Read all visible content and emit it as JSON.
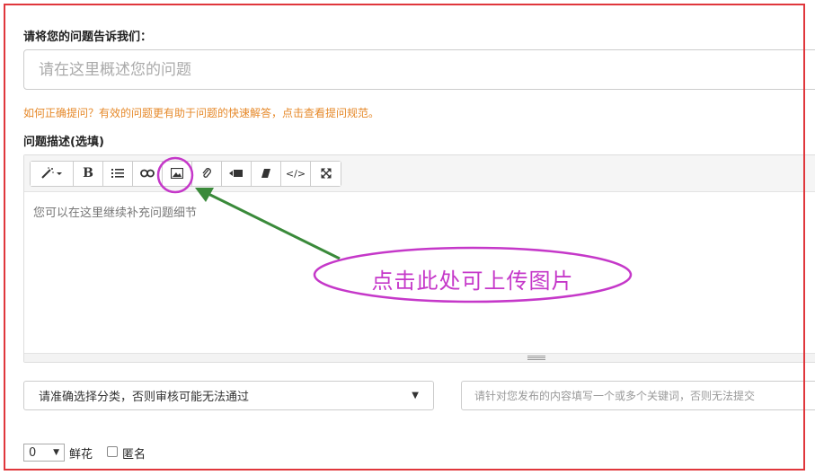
{
  "form": {
    "question_label": "请将您的问题告诉我们：",
    "title_placeholder": "请在这里概述您的问题",
    "help_text": "如何正确提问？有效的问题更有助于问题的快速解答，点击查看提问规范。",
    "description_label": "问题描述(选填)"
  },
  "editor": {
    "toolbar": [
      {
        "name": "magic-wand-icon",
        "glyph": "✎▾"
      },
      {
        "name": "bold-icon",
        "glyph": "B"
      },
      {
        "name": "ordered-list-icon",
        "glyph": "≡"
      },
      {
        "name": "link-icon",
        "glyph": "∞"
      },
      {
        "name": "image-icon",
        "glyph": "▣"
      },
      {
        "name": "attachment-icon",
        "glyph": "⌀"
      },
      {
        "name": "video-icon",
        "glyph": "▶"
      },
      {
        "name": "eraser-icon",
        "glyph": "▰"
      },
      {
        "name": "code-icon",
        "glyph": "</>"
      },
      {
        "name": "fullscreen-icon",
        "glyph": "⤧"
      }
    ],
    "body_text": "您可以在这里继续补充问题细节"
  },
  "category": {
    "selected": "请准确选择分类，否则审核可能无法通过"
  },
  "keywords": {
    "placeholder": "请针对您发布的内容填写一个或多个关键词，否则无法提交"
  },
  "reward": {
    "selected": "0",
    "flower_label": "鲜花",
    "anonymous_label": "匿名"
  },
  "annotation": {
    "callout": "点击此处可上传图片",
    "color_highlight": "#c538c9",
    "color_arrow": "#3a8a3a",
    "color_frame": "#e0373c"
  }
}
